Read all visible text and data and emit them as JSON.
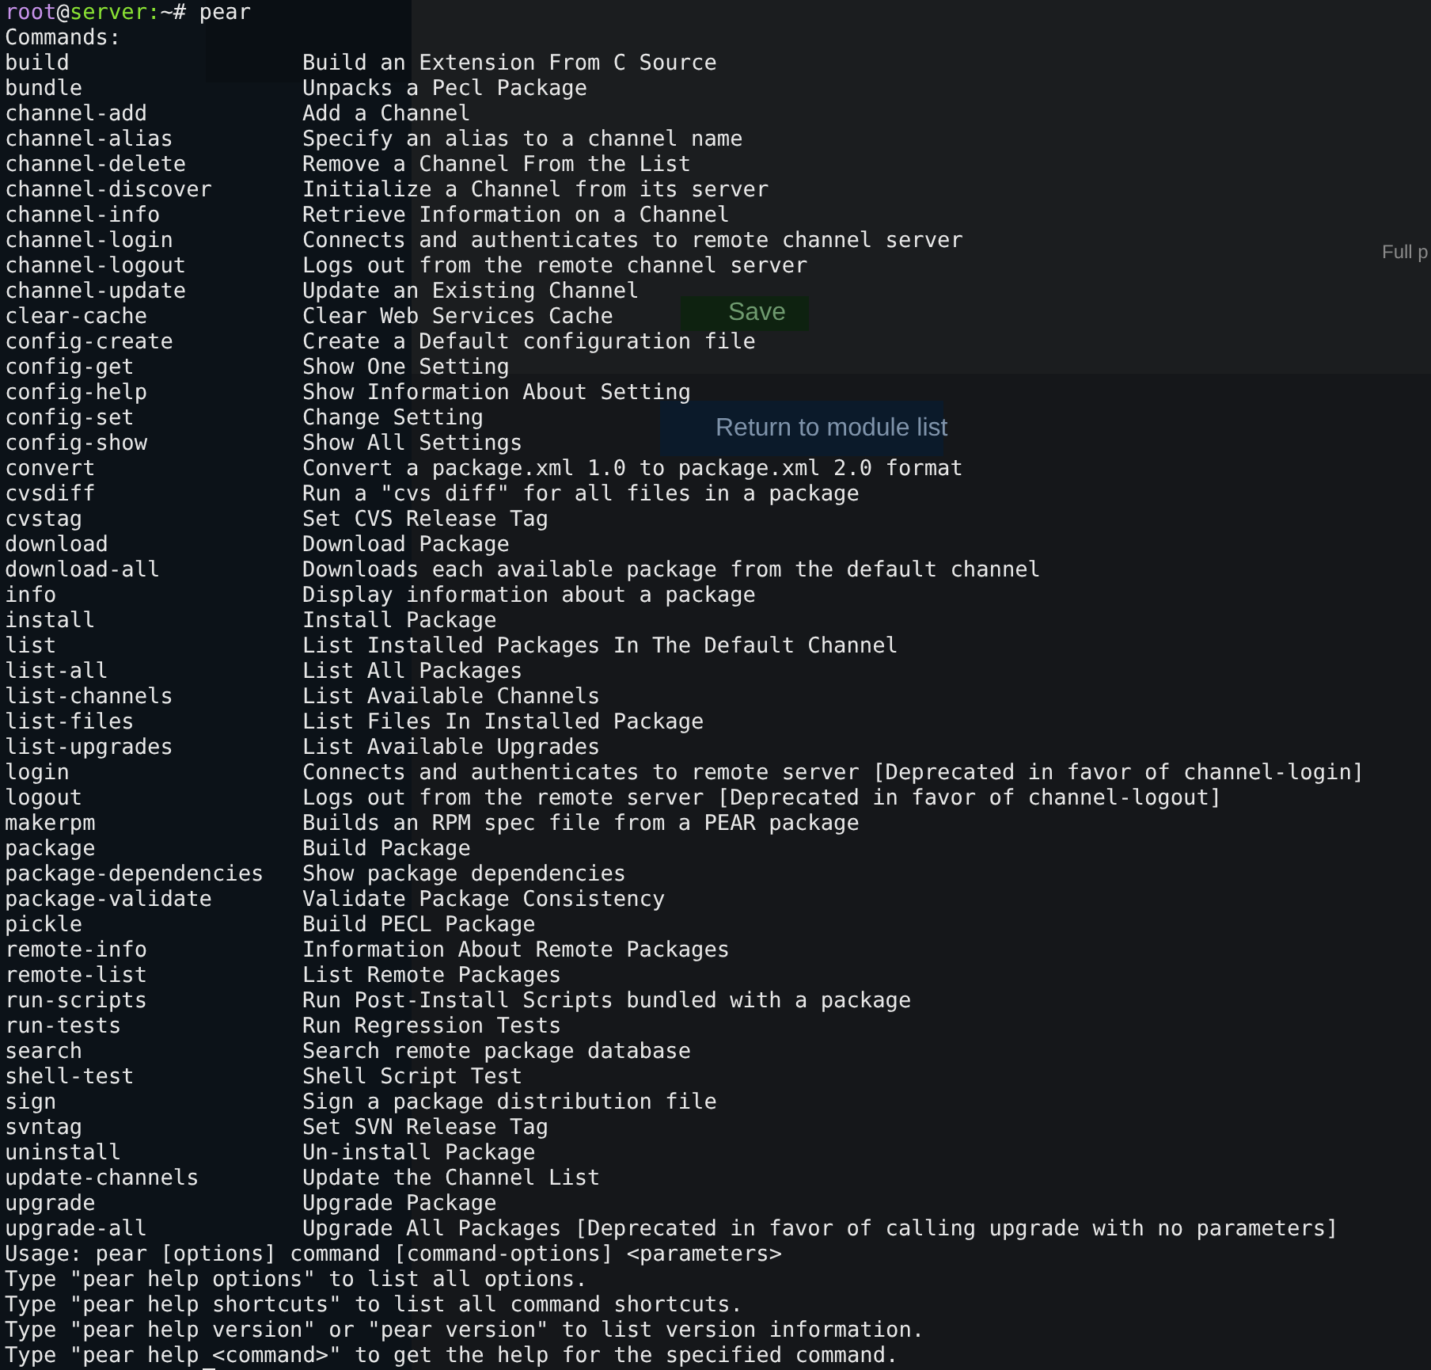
{
  "background_page": {
    "label": "Full p",
    "save_button": "Save",
    "return_button": "Return to module list"
  },
  "terminal": {
    "prompt": {
      "user": "root",
      "at": "@",
      "host": "server",
      "path": ":~#",
      "command": "pear"
    },
    "header": "Commands:",
    "commands": [
      {
        "name": "build",
        "description": "Build an Extension From C Source"
      },
      {
        "name": "bundle",
        "description": "Unpacks a Pecl Package"
      },
      {
        "name": "channel-add",
        "description": "Add a Channel"
      },
      {
        "name": "channel-alias",
        "description": "Specify an alias to a channel name"
      },
      {
        "name": "channel-delete",
        "description": "Remove a Channel From the List"
      },
      {
        "name": "channel-discover",
        "description": "Initialize a Channel from its server"
      },
      {
        "name": "channel-info",
        "description": "Retrieve Information on a Channel"
      },
      {
        "name": "channel-login",
        "description": "Connects and authenticates to remote channel server"
      },
      {
        "name": "channel-logout",
        "description": "Logs out from the remote channel server"
      },
      {
        "name": "channel-update",
        "description": "Update an Existing Channel"
      },
      {
        "name": "clear-cache",
        "description": "Clear Web Services Cache"
      },
      {
        "name": "config-create",
        "description": "Create a Default configuration file"
      },
      {
        "name": "config-get",
        "description": "Show One Setting"
      },
      {
        "name": "config-help",
        "description": "Show Information About Setting"
      },
      {
        "name": "config-set",
        "description": "Change Setting"
      },
      {
        "name": "config-show",
        "description": "Show All Settings"
      },
      {
        "name": "convert",
        "description": "Convert a package.xml 1.0 to package.xml 2.0 format"
      },
      {
        "name": "cvsdiff",
        "description": "Run a \"cvs diff\" for all files in a package"
      },
      {
        "name": "cvstag",
        "description": "Set CVS Release Tag"
      },
      {
        "name": "download",
        "description": "Download Package"
      },
      {
        "name": "download-all",
        "description": "Downloads each available package from the default channel"
      },
      {
        "name": "info",
        "description": "Display information about a package"
      },
      {
        "name": "install",
        "description": "Install Package"
      },
      {
        "name": "list",
        "description": "List Installed Packages In The Default Channel"
      },
      {
        "name": "list-all",
        "description": "List All Packages"
      },
      {
        "name": "list-channels",
        "description": "List Available Channels"
      },
      {
        "name": "list-files",
        "description": "List Files In Installed Package"
      },
      {
        "name": "list-upgrades",
        "description": "List Available Upgrades"
      },
      {
        "name": "login",
        "description": "Connects and authenticates to remote server [Deprecated in favor of channel-login]"
      },
      {
        "name": "logout",
        "description": "Logs out from the remote server [Deprecated in favor of channel-logout]"
      },
      {
        "name": "makerpm",
        "description": "Builds an RPM spec file from a PEAR package"
      },
      {
        "name": "package",
        "description": "Build Package"
      },
      {
        "name": "package-dependencies",
        "description": "Show package dependencies"
      },
      {
        "name": "package-validate",
        "description": "Validate Package Consistency"
      },
      {
        "name": "pickle",
        "description": "Build PECL Package"
      },
      {
        "name": "remote-info",
        "description": "Information About Remote Packages"
      },
      {
        "name": "remote-list",
        "description": "List Remote Packages"
      },
      {
        "name": "run-scripts",
        "description": "Run Post-Install Scripts bundled with a package"
      },
      {
        "name": "run-tests",
        "description": "Run Regression Tests"
      },
      {
        "name": "search",
        "description": "Search remote package database"
      },
      {
        "name": "shell-test",
        "description": "Shell Script Test"
      },
      {
        "name": "sign",
        "description": "Sign a package distribution file"
      },
      {
        "name": "svntag",
        "description": "Set SVN Release Tag"
      },
      {
        "name": "uninstall",
        "description": "Un-install Package"
      },
      {
        "name": "update-channels",
        "description": "Update the Channel List"
      },
      {
        "name": "upgrade",
        "description": "Upgrade Package"
      },
      {
        "name": "upgrade-all",
        "description": "Upgrade All Packages [Deprecated in favor of calling upgrade with no parameters]"
      }
    ],
    "usage": [
      "Usage: pear [options] command [command-options] <parameters>",
      "Type \"pear help options\" to list all options.",
      "Type \"pear help shortcuts\" to list all command shortcuts.",
      "Type \"pear help version\" or \"pear version\" to list version information.",
      "Type \"pear help <command>\" to get the help for the specified command."
    ]
  }
}
